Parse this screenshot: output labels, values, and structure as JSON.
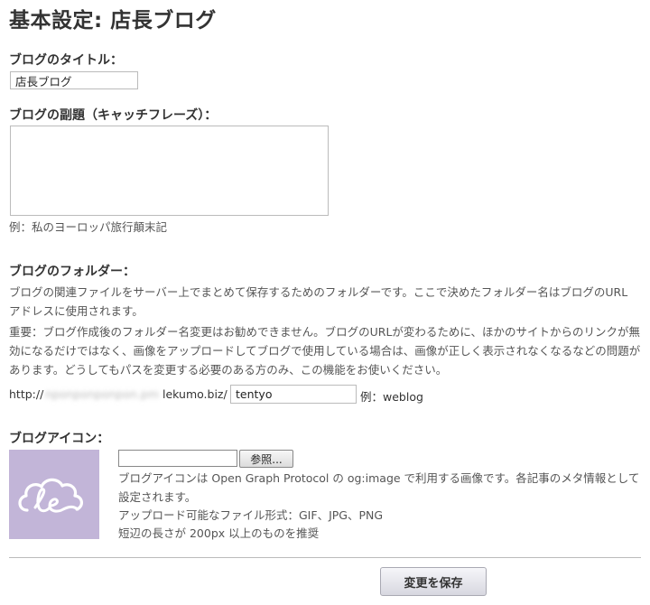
{
  "page": {
    "title": "基本設定: 店長ブログ"
  },
  "blog_title": {
    "label": "ブログのタイトル：",
    "value": "店長ブログ"
  },
  "subtitle": {
    "label": "ブログの副題（キャッチフレーズ）：",
    "value": "",
    "example": "例：私のヨーロッパ旅行顛末記"
  },
  "folder": {
    "label": "ブログのフォルダー：",
    "description": "ブログの関連ファイルをサーバー上でまとめて保存するためのフォルダーです。ここで決めたフォルダー名はブログのURLアドレスに使用されます。",
    "warning": "重要：ブログ作成後のフォルダー名変更はお勧めできません。ブログのURLが変わるために、ほかのサイトからのリンクが無効になるだけではなく、画像をアップロードしてブログで使用している場合は、画像が正しく表示されなくなるなどの問題があります。どうしてもパスを変更する必要のある方のみ、この機能をお使いください。",
    "url_prefix": "http://",
    "url_blurred": "nponponponpon.pm",
    "url_domain": "lekumo.biz/",
    "value": "tentyo",
    "example": "例：weblog"
  },
  "icon": {
    "label": "ブログアイコン：",
    "browse_label": "参照...",
    "description": "ブログアイコンは Open Graph Protocol の og:image で利用する画像です。各記事のメタ情報として設定されます。",
    "formats": "アップロード可能なファイル形式：GIF、JPG、PNG",
    "size_note": "短辺の長さが 200px 以上のものを推奨",
    "preview_color": "#c2b5d8",
    "preview_icon": "cloud-le-logo-icon"
  },
  "actions": {
    "save_label": "変更を保存"
  }
}
